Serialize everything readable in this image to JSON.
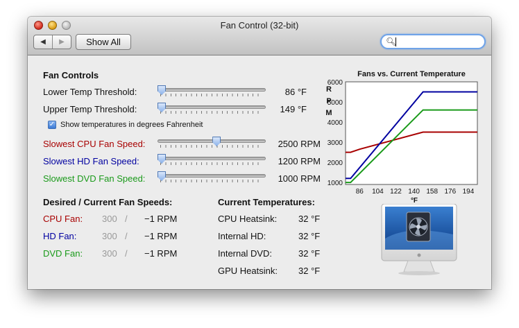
{
  "window": {
    "title": "Fan Control (32-bit)"
  },
  "toolbar": {
    "back_symbol": "◀",
    "forward_symbol": "▶",
    "show_all_label": "Show All",
    "search_value": ""
  },
  "controls": {
    "heading": "Fan Controls",
    "lower_threshold": {
      "label": "Lower Temp Threshold:",
      "value": "86 °F",
      "fraction": 0.0
    },
    "upper_threshold": {
      "label": "Upper Temp Threshold:",
      "value": "149 °F",
      "fraction": 0.0
    },
    "fahrenheit_checkbox": {
      "label": "Show temperatures in degrees Fahrenheit",
      "checked": true
    },
    "cpu_speed": {
      "label": "Slowest CPU Fan Speed:",
      "value": "2500 RPM",
      "fraction": 0.55,
      "color": "#a80000"
    },
    "hd_speed": {
      "label": "Slowest HD Fan Speed:",
      "value": "1200 RPM",
      "fraction": 0.0,
      "color": "#0000a0"
    },
    "dvd_speed": {
      "label": "Slowest DVD Fan Speed:",
      "value": "1000 RPM",
      "fraction": 0.0,
      "color": "#1a9a1a"
    }
  },
  "speeds": {
    "heading": "Desired / Current Fan Speeds:",
    "separator": "/",
    "rows": [
      {
        "label": "CPU Fan:",
        "desired": "300",
        "current": "−1 RPM",
        "color": "#a80000"
      },
      {
        "label": "HD Fan:",
        "desired": "300",
        "current": "−1 RPM",
        "color": "#0000a0"
      },
      {
        "label": "DVD Fan:",
        "desired": "300",
        "current": "−1 RPM",
        "color": "#1a9a1a"
      }
    ]
  },
  "temperatures": {
    "heading": "Current Temperatures:",
    "rows": [
      {
        "label": "CPU Heatsink:",
        "value": "32 °F"
      },
      {
        "label": "Internal HD:",
        "value": "32 °F"
      },
      {
        "label": "Internal DVD:",
        "value": "32 °F"
      },
      {
        "label": "GPU Heatsink:",
        "value": "32 °F"
      }
    ]
  },
  "chart_data": {
    "type": "line",
    "title": "Fans vs. Current Temperature",
    "ylabel": "R P M",
    "xlabel": "°F",
    "xlim": [
      72,
      203
    ],
    "ylim": [
      900,
      6000
    ],
    "x_ticks": [
      86,
      104,
      122,
      140,
      158,
      176,
      194
    ],
    "y_ticks": [
      1000,
      2000,
      3000,
      4000,
      5000,
      6000
    ],
    "grid": false,
    "series": [
      {
        "color": "#a80000",
        "points": [
          [
            72,
            2500
          ],
          [
            77,
            2500
          ],
          [
            86,
            2650
          ],
          [
            149,
            3500
          ],
          [
            203,
            3500
          ]
        ]
      },
      {
        "color": "#0000a0",
        "points": [
          [
            72,
            1200
          ],
          [
            77,
            1200
          ],
          [
            149,
            5500
          ],
          [
            203,
            5500
          ]
        ]
      },
      {
        "color": "#1a9a1a",
        "points": [
          [
            72,
            1000
          ],
          [
            77,
            1000
          ],
          [
            149,
            4600
          ],
          [
            203,
            4600
          ]
        ]
      }
    ]
  },
  "icons": {
    "search": "magnifier-icon",
    "checkmark": "✓",
    "monitor": "imac-fan-icon"
  }
}
